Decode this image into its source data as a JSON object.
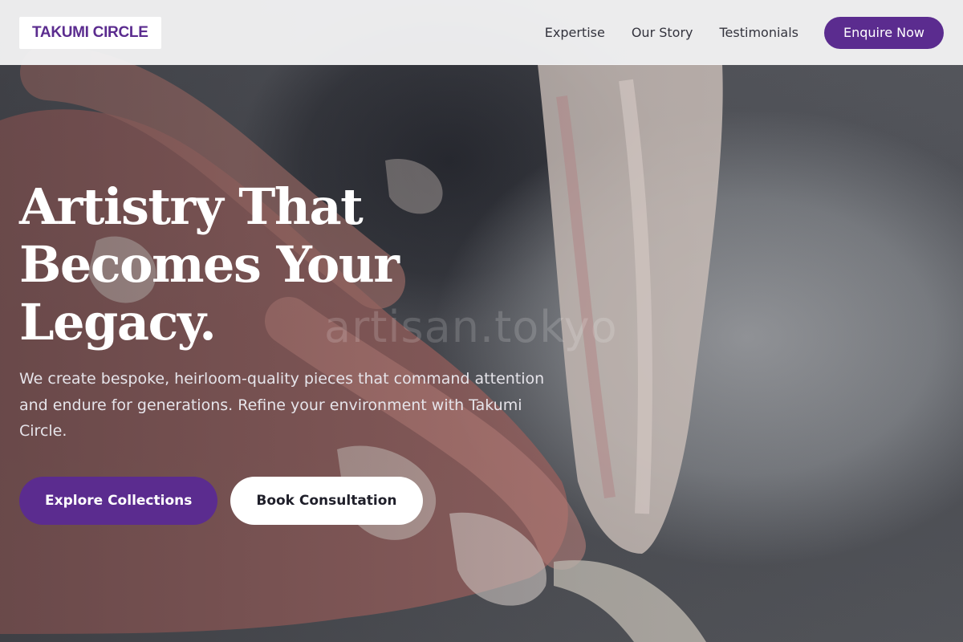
{
  "header": {
    "logo_text": "TAKUMI CIRCLE",
    "nav": [
      {
        "label": "Expertise"
      },
      {
        "label": "Our Story"
      },
      {
        "label": "Testimonials"
      }
    ],
    "cta_label": "Enquire Now"
  },
  "hero": {
    "title_lines": [
      "Artistry That",
      "Becomes Your",
      "Legacy."
    ],
    "subtitle": "We create bespoke, heirloom-quality pieces that command attention and endure for generations. Refine your environment with Takumi Circle.",
    "primary_button": "Explore Collections",
    "secondary_button": "Book Consultation",
    "watermark": "artisan.tokyo"
  },
  "colors": {
    "brand_purple": "#5b2c8f",
    "header_bg": "#f5f5f7",
    "hero_text": "#ffffff"
  }
}
